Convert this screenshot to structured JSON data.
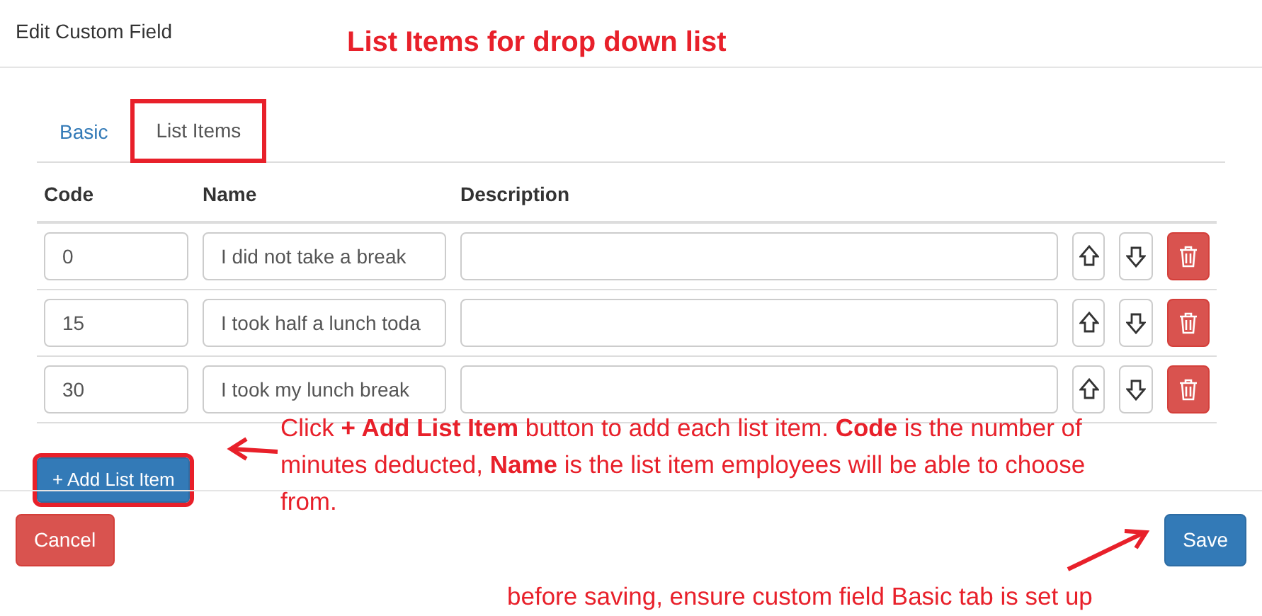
{
  "dialog": {
    "title": "Edit Custom Field"
  },
  "annotation_title": "List Items for drop down list",
  "tabs": [
    {
      "label": "Basic",
      "selected": false,
      "highlighted": false
    },
    {
      "label": "List Items",
      "selected": true,
      "highlighted": true
    }
  ],
  "table": {
    "columns": [
      "Code",
      "Name",
      "Description"
    ],
    "rows": [
      {
        "code": "0",
        "name": "I did not take a break",
        "description": ""
      },
      {
        "code": "15",
        "name": "I took half a lunch toda",
        "description": ""
      },
      {
        "code": "30",
        "name": "I took my lunch break",
        "description": ""
      }
    ]
  },
  "add_button": {
    "icon": "+",
    "label": "Add List Item",
    "highlighted": true
  },
  "annotation_note": "Click **+ Add List Item** button to add each list item. **Code** is the number of minutes deducted, **Name** is the list item employees will be able to choose from.",
  "footer": {
    "cancel": "Cancel",
    "save": "Save"
  },
  "annotation_footer": "before saving, ensure custom field Basic tab is set up"
}
